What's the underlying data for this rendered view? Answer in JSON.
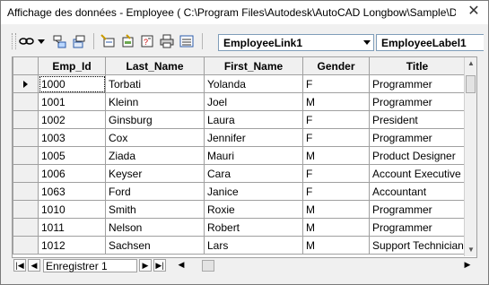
{
  "window": {
    "title": "Affichage des données - Employee ( C:\\Program Files\\Autodesk\\AutoCAD Longbow\\Sample\\D...",
    "close_label": "✕"
  },
  "toolbar": {
    "buttons": [
      "link-icon",
      "dropdown-arrow-icon",
      "link-select-icon",
      "link-new-icon",
      "label-icon",
      "label-update-icon",
      "find-replace-icon",
      "print-icon",
      "format-icon"
    ],
    "link_combo": "EmployeeLink1",
    "label_combo": "EmployeeLabel1"
  },
  "grid": {
    "columns": [
      "Emp_Id",
      "Last_Name",
      "First_Name",
      "Gender",
      "Title"
    ],
    "rows": [
      [
        "1000",
        "Torbati",
        "Yolanda",
        "F",
        "Programmer"
      ],
      [
        "1001",
        "Kleinn",
        "Joel",
        "M",
        "Programmer"
      ],
      [
        "1002",
        "Ginsburg",
        "Laura",
        "F",
        "President"
      ],
      [
        "1003",
        "Cox",
        "Jennifer",
        "F",
        "Programmer"
      ],
      [
        "1005",
        "Ziada",
        "Mauri",
        "M",
        "Product Designer"
      ],
      [
        "1006",
        "Keyser",
        "Cara",
        "F",
        "Account Executive"
      ],
      [
        "1063",
        "Ford",
        "Janice",
        "F",
        "Accountant"
      ],
      [
        "1010",
        "Smith",
        "Roxie",
        "M",
        "Programmer"
      ],
      [
        "1011",
        "Nelson",
        "Robert",
        "M",
        "Programmer"
      ],
      [
        "1012",
        "Sachsen",
        "Lars",
        "M",
        "Support Technician"
      ]
    ]
  },
  "navigator": {
    "record_label": "Enregistrer 1"
  }
}
